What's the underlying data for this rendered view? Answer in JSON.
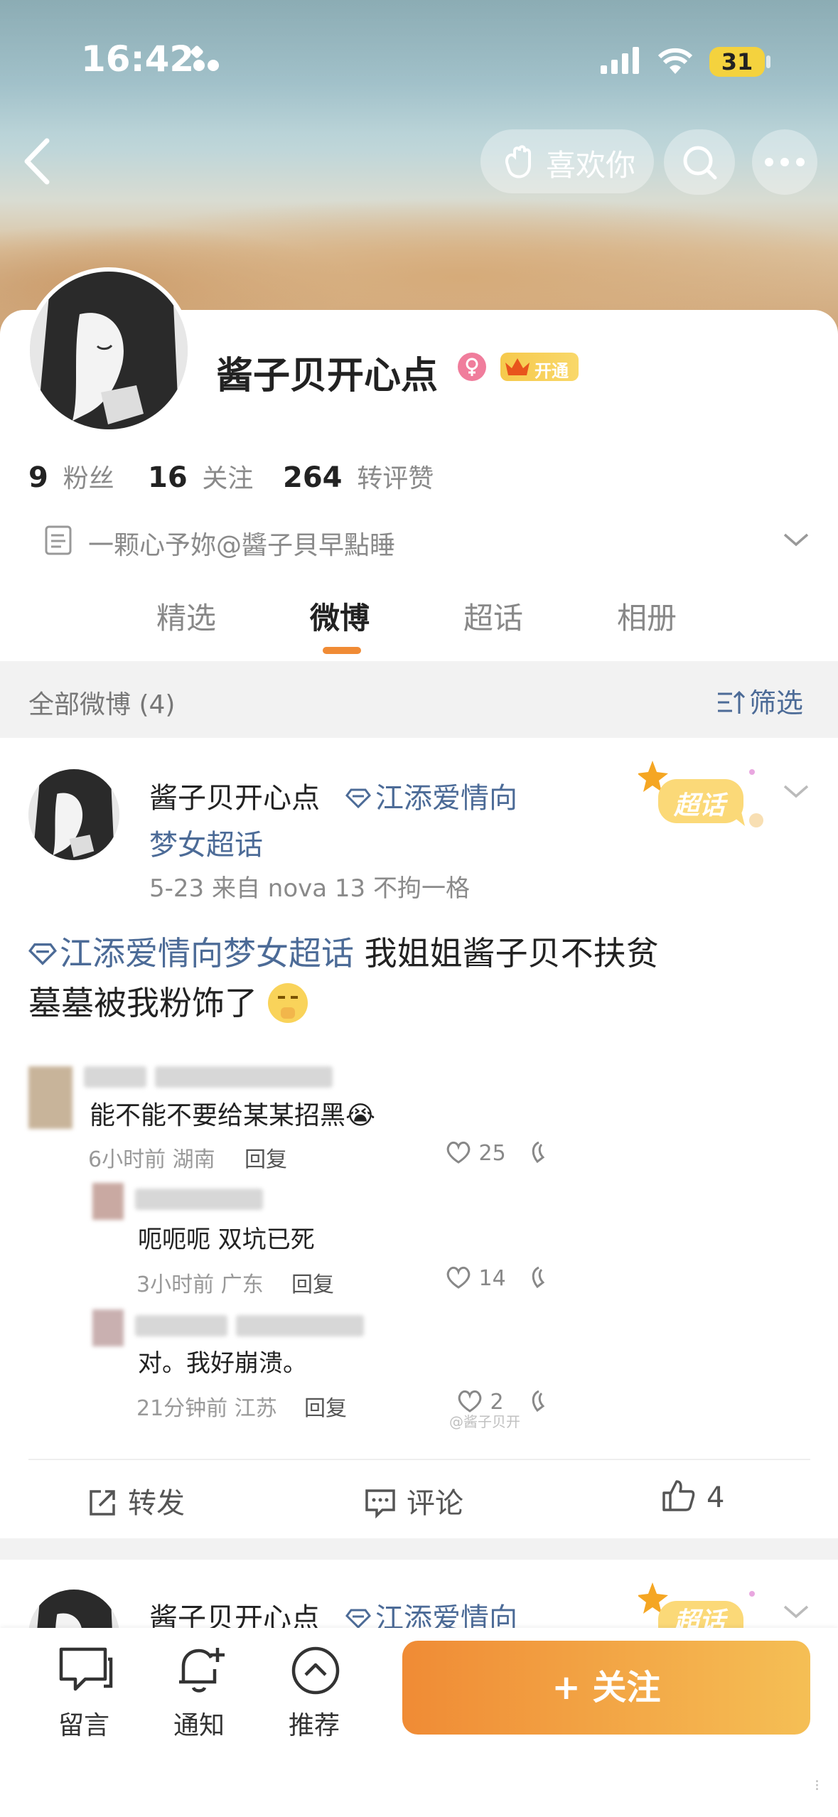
{
  "status_bar": {
    "time": "16:42",
    "battery": "31"
  },
  "header": {
    "like_label": "喜欢你"
  },
  "profile": {
    "name": "酱子贝开心点",
    "vip_badge": "开通",
    "stats": [
      {
        "value": "9",
        "label": "粉丝"
      },
      {
        "value": "16",
        "label": "关注"
      },
      {
        "value": "264",
        "label": "转评赞"
      }
    ],
    "bio": "一颗心予妳@醬子貝早點睡"
  },
  "tabs": [
    {
      "label": "精选",
      "active": false
    },
    {
      "label": "微博",
      "active": true
    },
    {
      "label": "超话",
      "active": false
    },
    {
      "label": "相册",
      "active": false
    }
  ],
  "filter_bar": {
    "title": "全部微博 (4)",
    "filter_label": "筛选"
  },
  "post": {
    "author": "酱子贝开心点",
    "topic_line1": "江添爱情向",
    "topic_line2": "梦女超话",
    "meta": "5-23  来自 nova 13 不拘一格",
    "badge": "超话",
    "content_topic": "江添爱情向梦女超话",
    "content_line1": " 我姐姐酱子贝不扶贫",
    "content_line2": "墓墓被我粉饰了",
    "comments": [
      {
        "text": "能不能不要给某某招黑😭",
        "time": "6小时前 湖南",
        "reply": "回复",
        "likes": "25"
      },
      {
        "text": "呃呃呃 双坑已死",
        "time": "3小时前 广东",
        "reply": "回复",
        "likes": "14"
      },
      {
        "text": "对。我好崩溃。",
        "time": "21分钟前 江苏",
        "reply": "回复",
        "likes": "2"
      }
    ],
    "watermark": "@酱子贝开",
    "actions": {
      "repost": "转发",
      "comment": "评论",
      "likes": "4"
    }
  },
  "post2": {
    "author": "酱子贝开心点",
    "topic_line1": "江添爱情向",
    "badge": "超话"
  },
  "bottom_bar": {
    "items": [
      {
        "label": "留言",
        "icon": "message-icon"
      },
      {
        "label": "通知",
        "icon": "bell-plus-icon"
      },
      {
        "label": "推荐",
        "icon": "chevron-up-circle-icon"
      }
    ],
    "follow_label": "+ 关注"
  },
  "colors": {
    "accent": "#f08b35",
    "topic_blue": "#4c6b97"
  }
}
